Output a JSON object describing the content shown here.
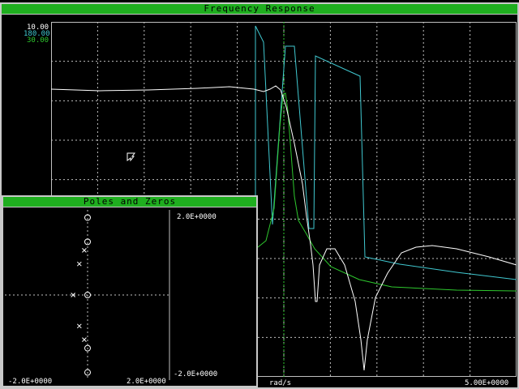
{
  "freq_window": {
    "title": "Frequency Response",
    "scales": {
      "magnitude": "10.00",
      "phase": "180.00",
      "delay": "30.00"
    },
    "x_unit": "rad/s",
    "x_max": "5.00E+0000",
    "colors": {
      "magnitude": "#ffffff",
      "phase": "#40c8d0",
      "delay": "#2ec82e",
      "grid": "#c0c0c0",
      "titlebar": "#1fae1f"
    }
  },
  "pz_window": {
    "title": "Poles and Zeros",
    "y_max": "2.0E+0000",
    "y_min": "-2.0E+0000",
    "x_min": "-2.0E+0000",
    "x_max": "2.0E+0000",
    "zeros": [
      [
        0,
        1.82
      ],
      [
        0,
        1.25
      ],
      [
        0,
        0
      ],
      [
        0,
        -1.25
      ],
      [
        0,
        -1.82
      ]
    ],
    "poles": [
      [
        -0.08,
        1.05
      ],
      [
        -0.2,
        0.73
      ],
      [
        -0.35,
        0
      ],
      [
        -0.2,
        -0.73
      ],
      [
        -0.08,
        -1.05
      ]
    ]
  }
}
